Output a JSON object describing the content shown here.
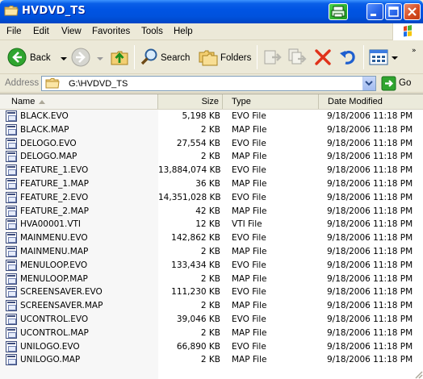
{
  "window": {
    "title": "HVDVD_TS"
  },
  "menu": {
    "items": [
      "File",
      "Edit",
      "View",
      "Favorites",
      "Tools",
      "Help"
    ]
  },
  "toolbar": {
    "back_label": "Back",
    "search_label": "Search",
    "folders_label": "Folders"
  },
  "address": {
    "label": "Address",
    "path": "G:\\HVDVD_TS",
    "go_label": "Go"
  },
  "columns": {
    "name": "Name",
    "size": "Size",
    "type": "Type",
    "date": "Date Modified"
  },
  "files": [
    {
      "name": "BLACK.EVO",
      "size": "5,198 KB",
      "type": "EVO File",
      "date": "9/18/2006 11:18 PM"
    },
    {
      "name": "BLACK.MAP",
      "size": "2 KB",
      "type": "MAP File",
      "date": "9/18/2006 11:18 PM"
    },
    {
      "name": "DELOGO.EVO",
      "size": "27,554 KB",
      "type": "EVO File",
      "date": "9/18/2006 11:18 PM"
    },
    {
      "name": "DELOGO.MAP",
      "size": "2 KB",
      "type": "MAP File",
      "date": "9/18/2006 11:18 PM"
    },
    {
      "name": "FEATURE_1.EVO",
      "size": "13,884,074 KB",
      "type": "EVO File",
      "date": "9/18/2006 11:18 PM"
    },
    {
      "name": "FEATURE_1.MAP",
      "size": "36 KB",
      "type": "MAP File",
      "date": "9/18/2006 11:18 PM"
    },
    {
      "name": "FEATURE_2.EVO",
      "size": "14,351,028 KB",
      "type": "EVO File",
      "date": "9/18/2006 11:18 PM"
    },
    {
      "name": "FEATURE_2.MAP",
      "size": "42 KB",
      "type": "MAP File",
      "date": "9/18/2006 11:18 PM"
    },
    {
      "name": "HVA00001.VTI",
      "size": "12 KB",
      "type": "VTI File",
      "date": "9/18/2006 11:18 PM"
    },
    {
      "name": "MAINMENU.EVO",
      "size": "142,862 KB",
      "type": "EVO File",
      "date": "9/18/2006 11:18 PM"
    },
    {
      "name": "MAINMENU.MAP",
      "size": "2 KB",
      "type": "MAP File",
      "date": "9/18/2006 11:18 PM"
    },
    {
      "name": "MENULOOP.EVO",
      "size": "133,434 KB",
      "type": "EVO File",
      "date": "9/18/2006 11:18 PM"
    },
    {
      "name": "MENULOOP.MAP",
      "size": "2 KB",
      "type": "MAP File",
      "date": "9/18/2006 11:18 PM"
    },
    {
      "name": "SCREENSAVER.EVO",
      "size": "111,230 KB",
      "type": "EVO File",
      "date": "9/18/2006 11:18 PM"
    },
    {
      "name": "SCREENSAVER.MAP",
      "size": "2 KB",
      "type": "MAP File",
      "date": "9/18/2006 11:18 PM"
    },
    {
      "name": "UCONTROL.EVO",
      "size": "39,046 KB",
      "type": "EVO File",
      "date": "9/18/2006 11:18 PM"
    },
    {
      "name": "UCONTROL.MAP",
      "size": "2 KB",
      "type": "MAP File",
      "date": "9/18/2006 11:18 PM"
    },
    {
      "name": "UNILOGO.EVO",
      "size": "66,890 KB",
      "type": "EVO File",
      "date": "9/18/2006 11:18 PM"
    },
    {
      "name": "UNILOGO.MAP",
      "size": "2 KB",
      "type": "MAP File",
      "date": "9/18/2006 11:18 PM"
    }
  ],
  "colors": {
    "titlebar_blue": "#0054E3",
    "chrome": "#ECE9D8",
    "close_red": "#D44A20"
  },
  "icons": {
    "title": "folder-icon",
    "back": "back-arrow-icon",
    "forward": "forward-arrow-icon",
    "up": "up-folder-icon",
    "search": "search-icon",
    "folders": "folders-icon",
    "move": "move-to-icon",
    "copy": "copy-to-icon",
    "delete": "delete-icon",
    "undo": "undo-icon",
    "views": "views-icon",
    "go": "go-arrow-icon",
    "file": "file-icon"
  }
}
